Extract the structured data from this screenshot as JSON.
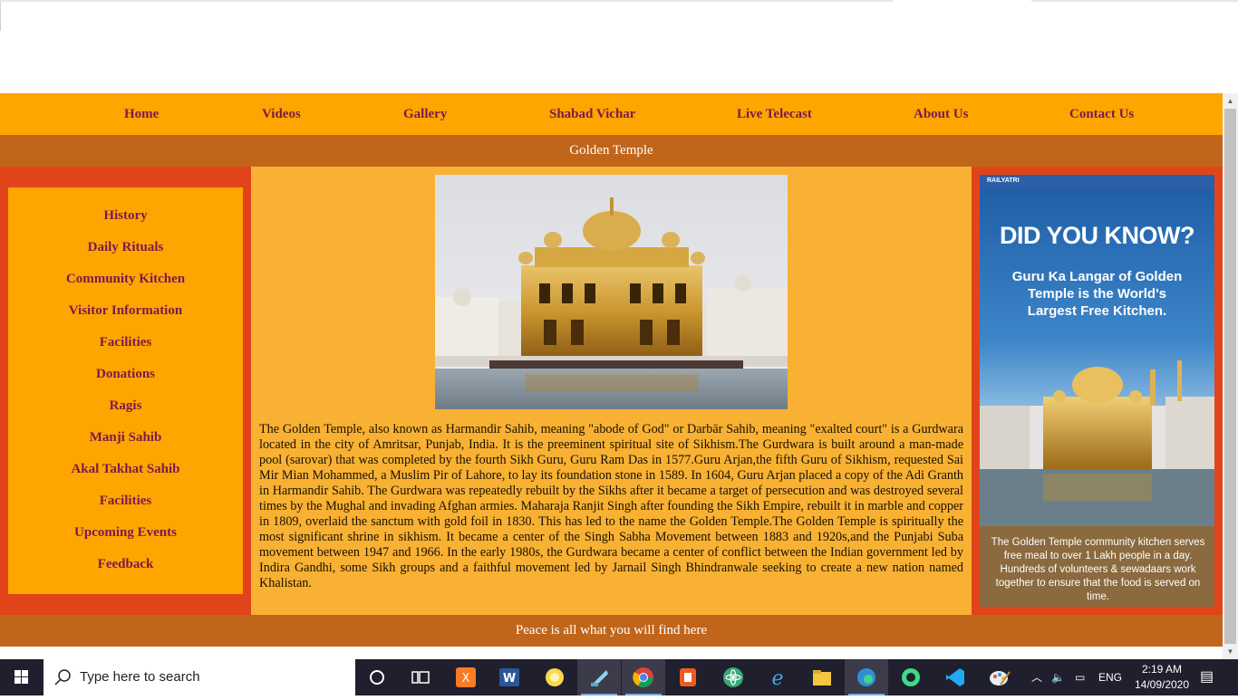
{
  "nav": {
    "items": [
      {
        "label": "Home"
      },
      {
        "label": "Videos"
      },
      {
        "label": "Gallery"
      },
      {
        "label": "Shabad Vichar"
      },
      {
        "label": "Live Telecast"
      },
      {
        "label": "About Us"
      },
      {
        "label": "Contact Us"
      }
    ]
  },
  "page": {
    "title": "Golden Temple",
    "footer": "Peace is all what you will find here"
  },
  "sidebar": {
    "items": [
      {
        "label": "History"
      },
      {
        "label": "Daily Rituals"
      },
      {
        "label": "Community Kitchen"
      },
      {
        "label": "Visitor Information"
      },
      {
        "label": "Facilities"
      },
      {
        "label": "Donations"
      },
      {
        "label": "Ragis"
      },
      {
        "label": "Manji Sahib"
      },
      {
        "label": "Akal Takhat Sahib"
      },
      {
        "label": "Facilities"
      },
      {
        "label": "Upcoming Events"
      },
      {
        "label": "Feedback"
      }
    ]
  },
  "article": {
    "text": "The Golden Temple, also known as Harmandir Sahib, meaning \"abode of God\" or Darbār Sahib, meaning \"exalted court\" is a Gurdwara located in the city of Amritsar, Punjab, India. It is the preeminent spiritual site of Sikhism.The Gurdwara is built around a man-made pool (sarovar) that was completed by the fourth Sikh Guru, Guru Ram Das in 1577.Guru Arjan,the fifth Guru of Sikhism, requested Sai Mir Mian Mohammed, a Muslim Pir of Lahore, to lay its foundation stone in 1589. In 1604, Guru Arjan placed a copy of the Adi Granth in Harmandir Sahib. The Gurdwara was repeatedly rebuilt by the Sikhs after it became a target of persecution and was destroyed several times by the Mughal and invading Afghan armies. Maharaja Ranjit Singh after founding the Sikh Empire, rebuilt it in marble and copper in 1809, overlaid the sanctum with gold foil in 1830. This has led to the name the Golden Temple.The Golden Temple is spiritually the most significant shrine in sikhism. It became a center of the Singh Sabha Movement between 1883 and 1920s,and the Punjabi Suba movement between 1947 and 1966. In the early 1980s, the Gurdwara became a center of conflict between the Indian government led by Indira Gandhi, some Sikh groups and a faithful movement led by Jarnail Singh Bhindranwale seeking to create a new nation named Khalistan."
  },
  "ad": {
    "brand": "RAILYATRI",
    "headline": "DID YOU KNOW?",
    "subheadline": "Guru Ka Langar of Golden Temple is the World's Largest Free Kitchen.",
    "caption": "The Golden Temple community kitchen serves free meal to over 1 Lakh people in a day. Hundreds of volunteers & sewadaars work together to ensure that the food is served on time."
  },
  "taskbar": {
    "search_placeholder": "Type here to search",
    "language": "ENG",
    "time": "2:19 AM",
    "date": "14/09/2020",
    "icons": [
      "start-icon",
      "cortana-icon",
      "task-view-icon",
      "xampp-icon",
      "word-icon",
      "sticky-notes-icon",
      "notepad-icon",
      "chrome-icon",
      "powerpoint-icon",
      "atom-icon",
      "internet-explorer-icon",
      "file-explorer-icon",
      "edge-icon",
      "android-studio-icon",
      "vscode-icon",
      "paint-icon"
    ]
  },
  "colors": {
    "nav_bg": "#ffa500",
    "nav_text": "#7a1a4e",
    "title_bg": "#c1651a",
    "side_bg": "#e2441a",
    "center_bg": "#f8b133"
  }
}
